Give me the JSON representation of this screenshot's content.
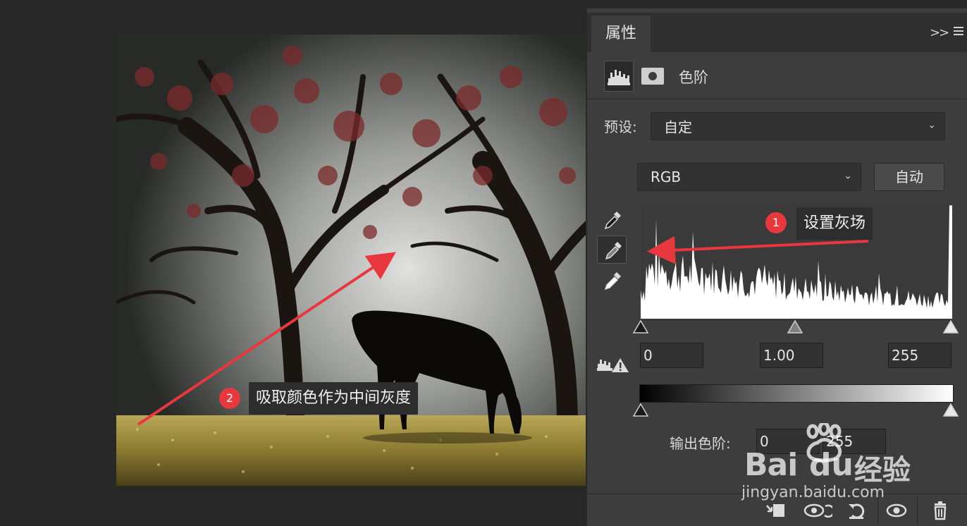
{
  "panel": {
    "tab_label": "属性",
    "collapse_glyph": ">>",
    "adjustment_title": "色阶",
    "preset_label": "预设:",
    "preset_value": "自定",
    "channel_value": "RGB",
    "auto_label": "自动",
    "input_black": "0",
    "input_gamma": "1.00",
    "input_white": "255",
    "output_label": "输出色阶:",
    "output_black": "0",
    "output_white": "255"
  },
  "annotations": {
    "step1_number": "1",
    "step1_text": "设置灰场",
    "step2_number": "2",
    "step2_text": "吸取颜色作为中间灰度"
  },
  "watermark": {
    "brand_bai": "Bai",
    "brand_du": "du",
    "brand_cn": "经验",
    "domain": "jingyan.baidu.com"
  },
  "icons": {
    "levels": "levels-histogram-icon",
    "mask": "layer-mask-icon",
    "eyedroppers": [
      "black-point-eyedropper-icon",
      "gray-point-eyedropper-icon",
      "white-point-eyedropper-icon"
    ],
    "bottom": [
      "clip-to-layer-icon",
      "view-previous-state-icon",
      "reset-icon",
      "visibility-eye-icon",
      "delete-icon"
    ]
  },
  "colors": {
    "annotation_red": "#e8383d",
    "panel_bg": "#3d3d3d"
  }
}
